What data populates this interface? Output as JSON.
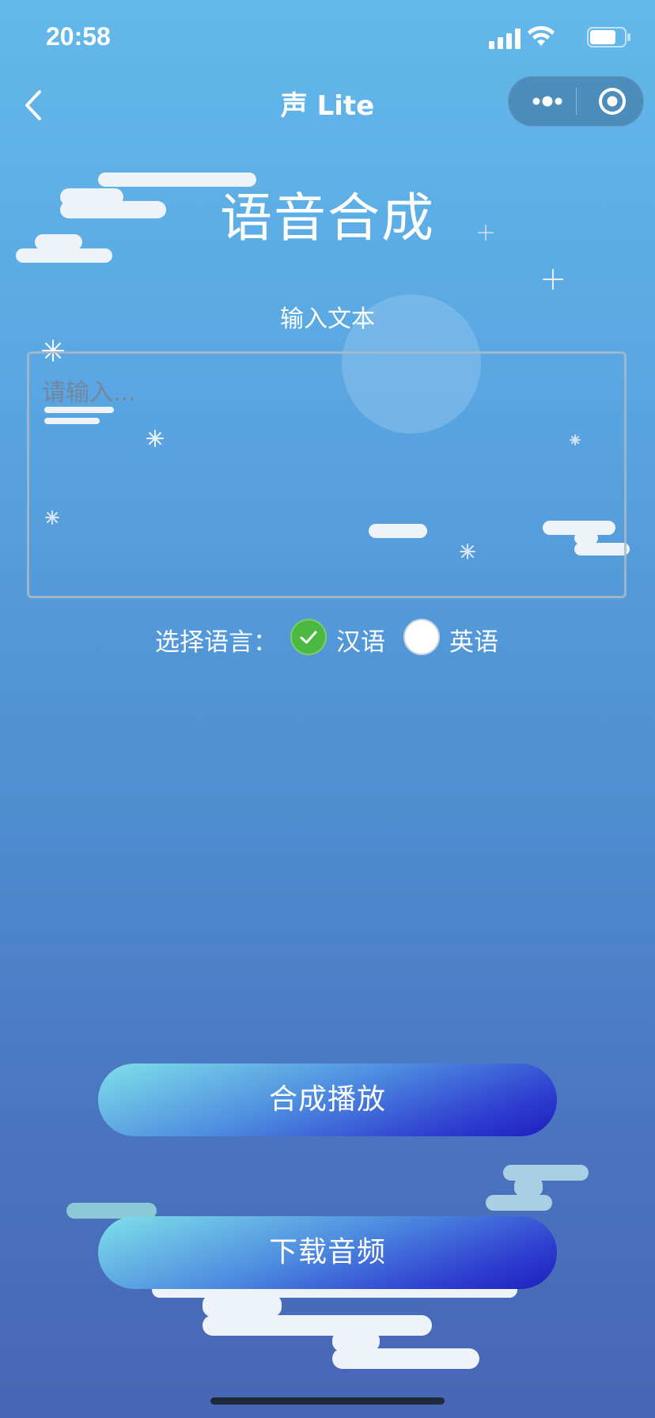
{
  "status_bar": {
    "time": "20:58"
  },
  "nav": {
    "title": "声 Lite"
  },
  "page": {
    "title": "语音合成",
    "input_label": "输入文本",
    "input_placeholder": "请输入...",
    "input_value": ""
  },
  "language": {
    "label": "选择语言：",
    "options": [
      {
        "label": "汉语",
        "selected": true
      },
      {
        "label": "英语",
        "selected": false
      }
    ]
  },
  "buttons": {
    "play_label": "合成播放",
    "download_label": "下载音频"
  },
  "colors": {
    "accent_green": "#4bb842",
    "background_top": "#63b8ea",
    "background_bottom": "#4766b5"
  }
}
